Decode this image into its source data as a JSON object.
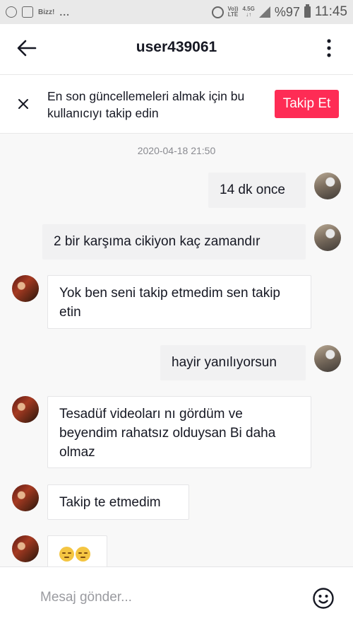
{
  "status_bar": {
    "app_label": "Bizz!",
    "dots": "...",
    "network_top": "Vo))",
    "network_bottom": "LTE",
    "speed_top": "4.5G",
    "speed_bottom": "↓↑",
    "battery": "%97",
    "time": "11:45"
  },
  "header": {
    "title": "user439061"
  },
  "banner": {
    "text": "En son güncellemeleri almak için bu kullanıcıyı takip edin",
    "follow_label": "Takip Et"
  },
  "chat": {
    "timestamp": "2020-04-18 21:50",
    "messages": [
      {
        "from": "me",
        "text": "14 dk once"
      },
      {
        "from": "me",
        "text": "2 bir karşıma cikiyon kaç zamandır"
      },
      {
        "from": "them",
        "text": "Yok ben seni takip etmedim sen takip etin"
      },
      {
        "from": "me",
        "text": "hayir yanılıyorsun"
      },
      {
        "from": "them",
        "text": "Tesadüf videoları nı gördüm ve beyendim rahatsız olduysan Bi daha olmaz"
      },
      {
        "from": "them",
        "text": "Takip te etmedim"
      },
      {
        "from": "them",
        "emoji": [
          "pensive-face",
          "pensive-face"
        ]
      }
    ]
  },
  "input": {
    "placeholder": "Mesaj gönder..."
  }
}
